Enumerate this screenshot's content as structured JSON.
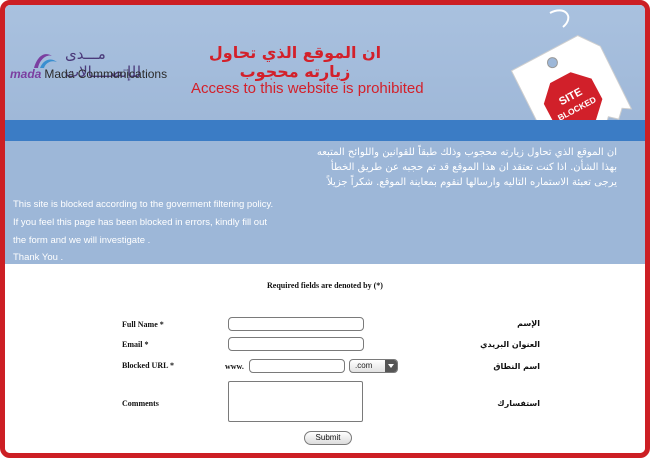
{
  "logo": {
    "arabic": "مـــدى للإتصــــالات",
    "brand": "mada",
    "name": "Mada Communications"
  },
  "header": {
    "title_ar": "ان الموقع الذي تحاول زيارته محجوب",
    "title_en": "Access to this website is prohibited"
  },
  "tag": {
    "line1": "SITE",
    "line2": "BLOCKED"
  },
  "message": {
    "arabic_lines": [
      "ان الموقع الذي تحاول زيارته محجوب وذلك طبقاً للقوانين واللوائح المتبعه",
      "بهذا الشأن. اذا كنت تعتقد ان هذا الموقع قد تم حجبه عن طريق الخطأ",
      "يرجى تعبئة الاستماره التاليه وارسالها لنقوم بمعاينة الموقع. شكراً جزيلاً"
    ],
    "english_lines": [
      "This site is blocked according to the goverment filtering policy.",
      "If you feel this page has been blocked in errors, kindly  fill out",
      "the form and we will investigate .",
      "Thank You ."
    ]
  },
  "form": {
    "required_note": "Required fields are denoted by (*)",
    "full_name_label": "Full Name *",
    "full_name_label_ar": "الإسم",
    "full_name_value": "",
    "email_label": "Email *",
    "email_label_ar": "العنوان البريدي",
    "email_value": "",
    "url_label": "Blocked URL *",
    "url_label_ar": "اسم النطاق",
    "url_prefix": "www.",
    "url_value": "",
    "tld_selected": ".com",
    "comments_label": "Comments",
    "comments_label_ar": "استفسارك",
    "comments_value": "",
    "submit_label": "Submit"
  },
  "colors": {
    "border": "#cc1f24",
    "header_bg": "#a9c1df",
    "accent_bar": "#3b7cc5",
    "title": "#d3202a"
  }
}
